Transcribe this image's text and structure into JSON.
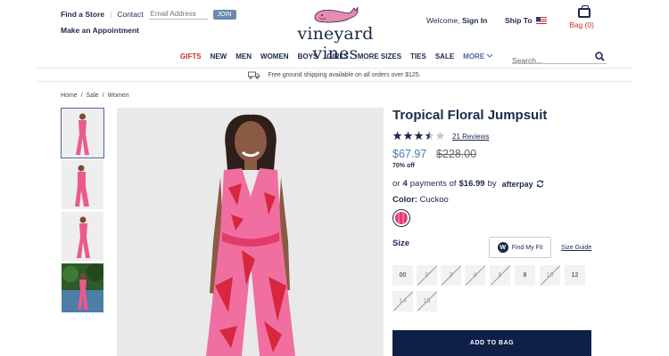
{
  "header": {
    "find_store": "Find a Store",
    "separator": "|",
    "contact": "Contact",
    "email_placeholder": "Email Address",
    "join": "JOIN",
    "appointment": "Make an Appointment",
    "brand": "vineyard vines",
    "welcome_prefix": "Welcome,",
    "sign_in": "Sign In",
    "ship_to": "Ship To",
    "bag_label": "Bag (0)"
  },
  "nav": {
    "items": [
      "GIFTS",
      "NEW",
      "MEN",
      "WOMEN",
      "BOYS",
      "GIRLS",
      "MORE SIZES",
      "TIES",
      "SALE",
      "MORE"
    ],
    "search_placeholder": "Search..."
  },
  "shipping_banner": "Free ground shipping available on all orders over $125.",
  "breadcrumb": [
    "Home",
    "/",
    "Sale",
    "/",
    "Women"
  ],
  "product": {
    "title": "Tropical Floral Jumpsuit",
    "rating": 3.5,
    "reviews": "21 Reviews",
    "sale_price": "$67.97",
    "original_price": "$228.00",
    "discount": "70% off",
    "afterpay": {
      "prefix": "or",
      "count": "4",
      "mid": "payments of",
      "amount": "$16.99",
      "suffix": "by",
      "brand": "afterpay"
    },
    "color_label": "Color:",
    "color_name": "Cuckoo",
    "size_label": "Size",
    "find_fit": "Find My Fit",
    "size_guide": "Size Guide",
    "sizes": [
      {
        "label": "00",
        "available": true
      },
      {
        "label": "0",
        "available": false
      },
      {
        "label": "2",
        "available": false
      },
      {
        "label": "4",
        "available": false
      },
      {
        "label": "6",
        "available": false
      },
      {
        "label": "8",
        "available": true
      },
      {
        "label": "10",
        "available": false
      },
      {
        "label": "12",
        "available": true
      },
      {
        "label": "14",
        "available": false
      },
      {
        "label": "16",
        "available": false
      }
    ],
    "add_to_bag": "ADD TO BAG"
  },
  "colors": {
    "navy": "#1b2a4a",
    "sale_blue": "#4a7ab0",
    "gift_red": "#c4302b",
    "jumpsuit_pink": "#f06fa0"
  }
}
